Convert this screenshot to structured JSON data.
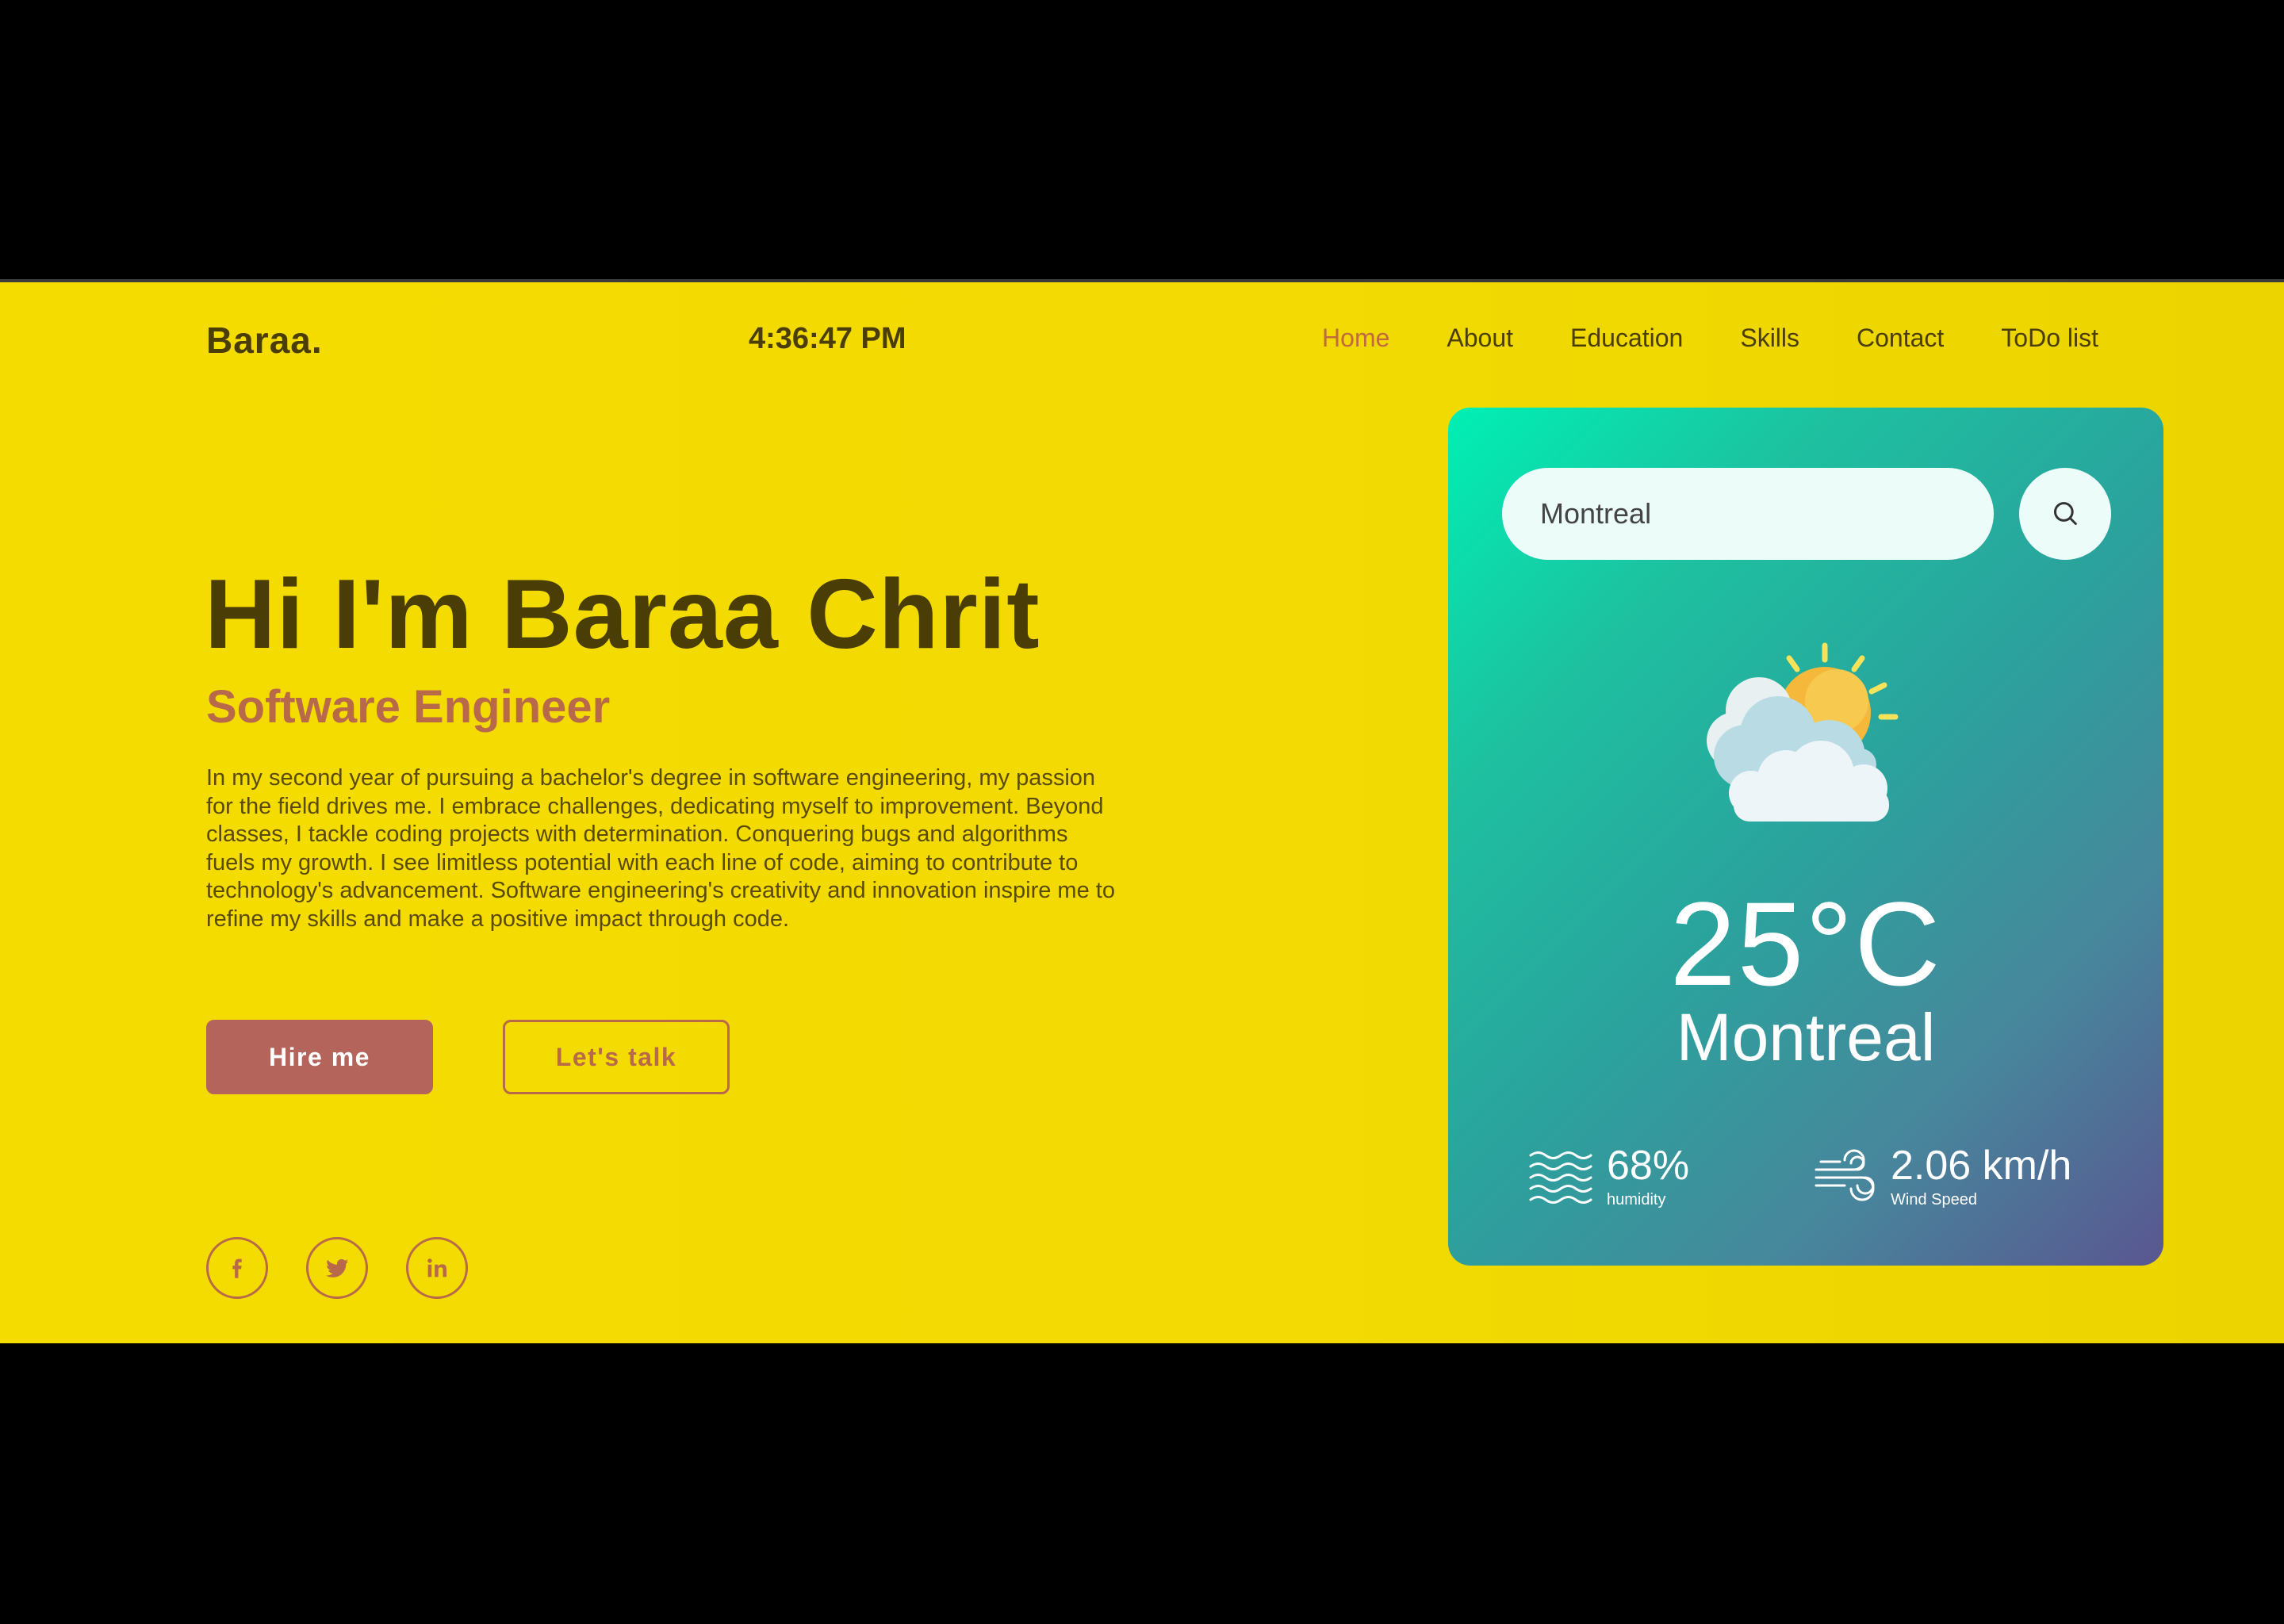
{
  "header": {
    "logo": "Baraa.",
    "clock": "4:36:47 PM",
    "nav": [
      "Home",
      "About",
      "Education",
      "Skills",
      "Contact",
      "ToDo list"
    ],
    "active_nav": "Home"
  },
  "hero": {
    "title": "Hi I'm Baraa Chrit",
    "subtitle": "Software Engineer",
    "description": "In my second year of pursuing a bachelor's degree in software engineering, my passion for the field drives me. I embrace challenges, dedicating myself to improvement. Beyond classes, I tackle coding projects with determination. Conquering bugs and algorithms fuels my growth. I see limitless potential with each line of code, aiming to contribute to technology's advancement. Software engineering's creativity and innovation inspire me to refine my skills and make a positive impact through code.",
    "hire_label": "Hire me",
    "talk_label": "Let's talk",
    "socials": [
      "facebook-icon",
      "twitter-icon",
      "linkedin-icon"
    ]
  },
  "weather": {
    "search_value": "Montreal",
    "temperature": "25°C",
    "city": "Montreal",
    "humidity_value": "68%",
    "humidity_label": "humidity",
    "wind_value": "2.06 km/h",
    "wind_label": "Wind Speed",
    "icon": "partly-cloudy-icon"
  },
  "colors": {
    "background": "#f2da02",
    "text_dark": "#4a3d05",
    "accent": "#b8694a",
    "button": "#b5645c",
    "card_gradient_start": "#00f0b4",
    "card_gradient_end": "#5a5690"
  }
}
